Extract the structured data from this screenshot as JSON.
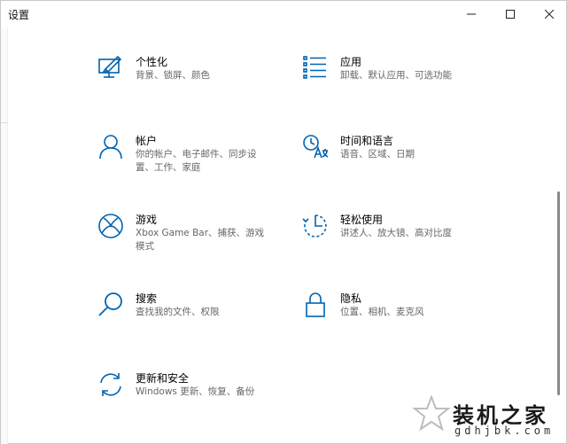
{
  "window": {
    "title": "设置",
    "minimize_glyph": "—",
    "maximize_glyph": "☐",
    "close_glyph": "✕"
  },
  "accent_color": "#0063b1",
  "tiles": [
    {
      "icon": "personalization-icon",
      "name": "个性化",
      "desc": "背景、锁屏、颜色"
    },
    {
      "icon": "apps-icon",
      "name": "应用",
      "desc": "卸载、默认应用、可选功能"
    },
    {
      "icon": "accounts-icon",
      "name": "帐户",
      "desc": "你的帐户、电子邮件、同步设置、工作、家庭"
    },
    {
      "icon": "time-language-icon",
      "name": "时间和语言",
      "desc": "语音、区域、日期"
    },
    {
      "icon": "xbox-icon",
      "name": "游戏",
      "desc": "Xbox Game Bar、捕获、游戏模式"
    },
    {
      "icon": "ease-of-access-icon",
      "name": "轻松使用",
      "desc": "讲述人、放大镜、高对比度"
    },
    {
      "icon": "search-icon",
      "name": "搜索",
      "desc": "查找我的文件、权限"
    },
    {
      "icon": "lock-icon",
      "name": "隐私",
      "desc": "位置、相机、麦克风"
    },
    {
      "icon": "update-icon",
      "name": "更新和安全",
      "desc": "Windows 更新、恢复、备份"
    }
  ],
  "watermark": {
    "text": "装机之家",
    "sub": "gdhjbk.com"
  }
}
